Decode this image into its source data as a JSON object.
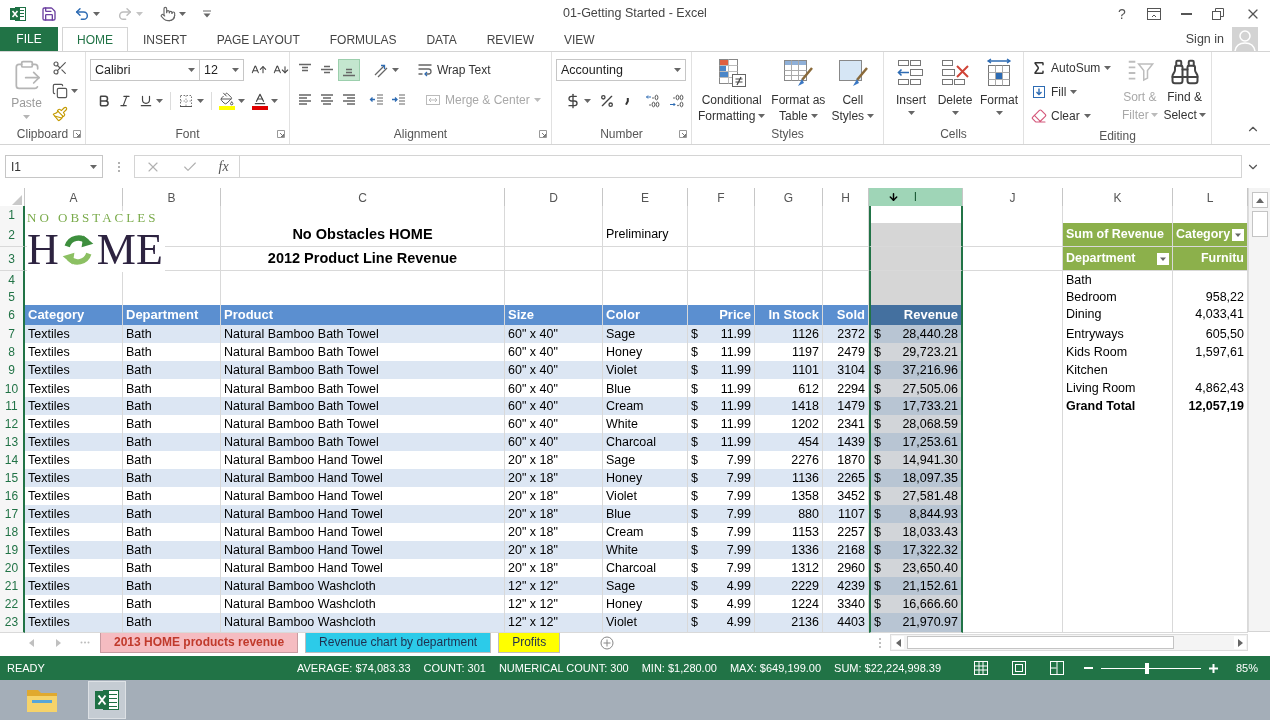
{
  "window": {
    "title": "01-Getting Started - Excel",
    "help": "?"
  },
  "file_tab": {
    "label": "FILE"
  },
  "tabs": [
    {
      "label": "HOME",
      "selected": true
    },
    {
      "label": "INSERT",
      "selected": false
    },
    {
      "label": "PAGE LAYOUT",
      "selected": false
    },
    {
      "label": "FORMULAS",
      "selected": false
    },
    {
      "label": "DATA",
      "selected": false
    },
    {
      "label": "REVIEW",
      "selected": false
    },
    {
      "label": "VIEW",
      "selected": false
    }
  ],
  "account": {
    "label": "Sign in"
  },
  "ribbon": {
    "clipboard": {
      "title": "Clipboard",
      "paste": {
        "label": "Paste",
        "disabled": true
      }
    },
    "font": {
      "title": "Font",
      "font_name": "Calibri",
      "font_size": "12"
    },
    "alignment": {
      "title": "Alignment",
      "vertical_align": [
        {
          "kind": "top",
          "selected": false
        },
        {
          "kind": "middle",
          "selected": false
        },
        {
          "kind": "bottom",
          "selected": true
        }
      ],
      "wrap_text": {
        "label": "Wrap Text"
      },
      "merge": {
        "label": "Merge & Center",
        "disabled": true
      }
    },
    "number": {
      "title": "Number",
      "format": "Accounting"
    },
    "styles": {
      "title": "Styles",
      "buttons": [
        {
          "kind": "conditional",
          "lines": [
            "Conditional",
            "Formatting"
          ]
        },
        {
          "kind": "table",
          "lines": [
            "Format as",
            "Table"
          ]
        },
        {
          "kind": "cell",
          "lines": [
            "Cell",
            "Styles"
          ]
        }
      ]
    },
    "cells": {
      "title": "Cells",
      "buttons": [
        {
          "kind": "insert",
          "label": "Insert"
        },
        {
          "kind": "delete",
          "label": "Delete"
        },
        {
          "kind": "format",
          "label": "Format"
        }
      ]
    },
    "editing": {
      "title": "Editing",
      "small_buttons": [
        {
          "kind": "autosum",
          "label": "AutoSum"
        },
        {
          "kind": "fill",
          "label": "Fill"
        },
        {
          "kind": "clear",
          "label": "Clear"
        }
      ],
      "large_buttons": [
        {
          "kind": "sort",
          "lines": [
            "Sort &",
            "Filter"
          ],
          "disabled": true
        },
        {
          "kind": "find",
          "lines": [
            "Find &",
            "Select"
          ],
          "disabled": false
        }
      ]
    }
  },
  "formula_bar": {
    "name_box": "I1",
    "function_label": "fx"
  },
  "sheet": {
    "columns": [
      {
        "letter": "A",
        "selected": false
      },
      {
        "letter": "B",
        "selected": false
      },
      {
        "letter": "C",
        "selected": false
      },
      {
        "letter": "D",
        "selected": false
      },
      {
        "letter": "E",
        "selected": false
      },
      {
        "letter": "F",
        "selected": false
      },
      {
        "letter": "G",
        "selected": false
      },
      {
        "letter": "H",
        "selected": false
      },
      {
        "letter": "I",
        "selected": true
      },
      {
        "letter": "J",
        "selected": false
      },
      {
        "letter": "K",
        "selected": false
      },
      {
        "letter": "L",
        "selected": false
      }
    ],
    "rows": [
      "1",
      "2",
      "3",
      "4",
      "5",
      "6",
      "7",
      "8",
      "9",
      "10",
      "11",
      "12",
      "13",
      "14",
      "15",
      "16",
      "17",
      "18",
      "19",
      "20",
      "21",
      "22",
      "23"
    ],
    "logo": {
      "tagline": "NO OBSTACLES",
      "word_start": "H",
      "word_end": "ME"
    },
    "title_lines": [
      "No Obstacles HOME",
      "2012 Product Line Revenue"
    ],
    "note": "Preliminary",
    "table": {
      "headers": [
        "Category",
        "Department",
        "Product",
        "Size",
        "Color",
        "Price",
        "In Stock",
        "Sold",
        "Revenue"
      ],
      "rows": [
        [
          "Textiles",
          "Bath",
          "Natural Bamboo Bath Towel",
          "60\" x 40\"",
          "Sage",
          "$",
          "11.99",
          "1126",
          "2372",
          "$",
          "28,440.28"
        ],
        [
          "Textiles",
          "Bath",
          "Natural Bamboo Bath Towel",
          "60\" x 40\"",
          "Honey",
          "$",
          "11.99",
          "1197",
          "2479",
          "$",
          "29,723.21"
        ],
        [
          "Textiles",
          "Bath",
          "Natural Bamboo Bath Towel",
          "60\" x 40\"",
          "Violet",
          "$",
          "11.99",
          "1101",
          "3104",
          "$",
          "37,216.96"
        ],
        [
          "Textiles",
          "Bath",
          "Natural Bamboo Bath Towel",
          "60\" x 40\"",
          "Blue",
          "$",
          "11.99",
          "612",
          "2294",
          "$",
          "27,505.06"
        ],
        [
          "Textiles",
          "Bath",
          "Natural Bamboo Bath Towel",
          "60\" x 40\"",
          "Cream",
          "$",
          "11.99",
          "1418",
          "1479",
          "$",
          "17,733.21"
        ],
        [
          "Textiles",
          "Bath",
          "Natural Bamboo Bath Towel",
          "60\" x 40\"",
          "White",
          "$",
          "11.99",
          "1202",
          "2341",
          "$",
          "28,068.59"
        ],
        [
          "Textiles",
          "Bath",
          "Natural Bamboo Bath Towel",
          "60\" x 40\"",
          "Charcoal",
          "$",
          "11.99",
          "454",
          "1439",
          "$",
          "17,253.61"
        ],
        [
          "Textiles",
          "Bath",
          "Natural Bamboo Hand Towel",
          "20\" x 18\"",
          "Sage",
          "$",
          "7.99",
          "2276",
          "1870",
          "$",
          "14,941.30"
        ],
        [
          "Textiles",
          "Bath",
          "Natural Bamboo Hand Towel",
          "20\" x 18\"",
          "Honey",
          "$",
          "7.99",
          "1136",
          "2265",
          "$",
          "18,097.35"
        ],
        [
          "Textiles",
          "Bath",
          "Natural Bamboo Hand Towel",
          "20\" x 18\"",
          "Violet",
          "$",
          "7.99",
          "1358",
          "3452",
          "$",
          "27,581.48"
        ],
        [
          "Textiles",
          "Bath",
          "Natural Bamboo Hand Towel",
          "20\" x 18\"",
          "Blue",
          "$",
          "7.99",
          "880",
          "1107",
          "$",
          "8,844.93"
        ],
        [
          "Textiles",
          "Bath",
          "Natural Bamboo Hand Towel",
          "20\" x 18\"",
          "Cream",
          "$",
          "7.99",
          "1153",
          "2257",
          "$",
          "18,033.43"
        ],
        [
          "Textiles",
          "Bath",
          "Natural Bamboo Hand Towel",
          "20\" x 18\"",
          "White",
          "$",
          "7.99",
          "1336",
          "2168",
          "$",
          "17,322.32"
        ],
        [
          "Textiles",
          "Bath",
          "Natural Bamboo Hand Towel",
          "20\" x 18\"",
          "Charcoal",
          "$",
          "7.99",
          "1312",
          "2960",
          "$",
          "23,650.40"
        ],
        [
          "Textiles",
          "Bath",
          "Natural Bamboo Washcloth",
          "12\" x 12\"",
          "Sage",
          "$",
          "4.99",
          "2229",
          "4239",
          "$",
          "21,152.61"
        ],
        [
          "Textiles",
          "Bath",
          "Natural Bamboo Washcloth",
          "12\" x 12\"",
          "Honey",
          "$",
          "4.99",
          "1224",
          "3340",
          "$",
          "16,666.60"
        ],
        [
          "Textiles",
          "Bath",
          "Natural Bamboo Washcloth",
          "12\" x 12\"",
          "Violet",
          "$",
          "4.99",
          "2136",
          "4403",
          "$",
          "21,970.97"
        ]
      ]
    },
    "pivot": {
      "corner": "Sum of Revenue",
      "column_field": "Category",
      "row_field": "Department",
      "column_item": "Furnitu",
      "rows": [
        {
          "label": "Bath"
        },
        {
          "label": "Bedroom",
          "value": "958,22"
        },
        {
          "label": "Dining",
          "value": "4,033,41"
        },
        {
          "label": "Entryways",
          "value": "605,50"
        },
        {
          "label": "Kids Room",
          "value": "1,597,61"
        },
        {
          "label": "Kitchen"
        },
        {
          "label": "Living Room",
          "value": "4,862,43"
        }
      ],
      "total": {
        "label": "Grand Total",
        "value": "12,057,19"
      }
    }
  },
  "sheet_tabs": [
    {
      "label": "2013 HOME products revenue",
      "color": "#f5bcc1",
      "selected": true
    },
    {
      "label": "Revenue chart by department",
      "color": "#2ccbe9",
      "selected": false
    },
    {
      "label": "Profits",
      "color": "#ffff00",
      "selected": false
    }
  ],
  "status_bar": {
    "mode": "READY",
    "stats": [
      "AVERAGE: $74,083.33",
      "COUNT: 301",
      "NUMERICAL COUNT: 300",
      "MIN: $1,280.00",
      "MAX: $649,199.00",
      "SUM: $22,224,998.39"
    ],
    "zoom": {
      "level": 0.46,
      "reading": "85%"
    }
  }
}
